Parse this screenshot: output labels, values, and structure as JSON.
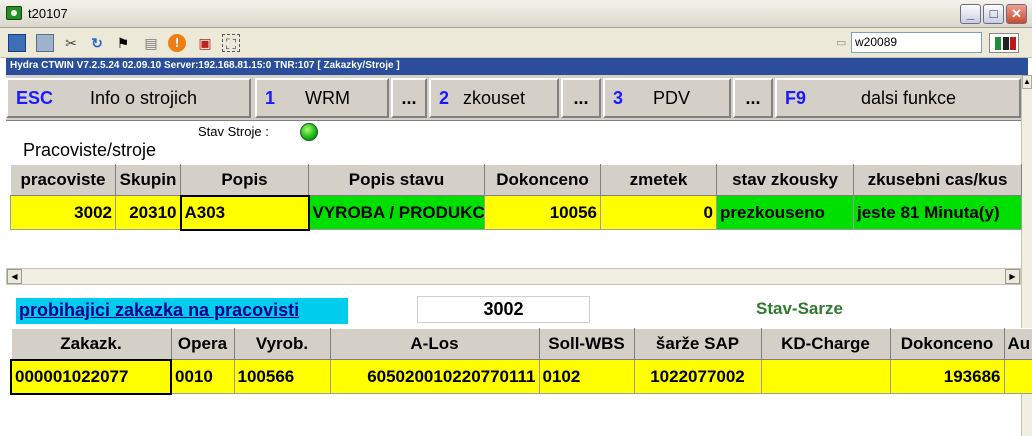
{
  "window": {
    "title": "t20107",
    "buttons": {
      "minimize": "_",
      "maximize": "□",
      "close": "✕"
    }
  },
  "toolbar": {
    "icons": [
      "monitor-icon",
      "windows-icon",
      "tools-icon",
      "refresh-icon",
      "windows-logo-icon",
      "printer-icon",
      "alert-icon",
      "network-icon",
      "fullscreen-icon"
    ],
    "terminal_value": "w20089"
  },
  "status_strip": {
    "text": "Hydra CTWIN V7.2.5.24  02.09.10  Server:192.168.81.15:0 TNR:107  [ Zakazky/Stroje ]"
  },
  "function_keys": [
    {
      "key": "ESC",
      "label": "Info o strojich"
    },
    {
      "key": "1",
      "label": "WRM"
    },
    {
      "key": "",
      "label": "..."
    },
    {
      "key": "2",
      "label": "zkouset"
    },
    {
      "key": "",
      "label": "..."
    },
    {
      "key": "3",
      "label": "PDV"
    },
    {
      "key": "",
      "label": "..."
    },
    {
      "key": "F9",
      "label": "dalsi funkce"
    }
  ],
  "machines": {
    "stav_label": "Stav Stroje :",
    "stav_color": "#13b313",
    "title": "Pracoviste/stroje",
    "columns": [
      "pracoviste",
      "Skupin",
      "Popis",
      "Popis stavu",
      "Dokonceno",
      "zmetek",
      "stav zkousky",
      "zkusebni cas/kus"
    ],
    "rows": [
      [
        "3002",
        "20310",
        "A303",
        "VYROBA / PRODUKCE",
        "10056",
        "0",
        "prezkouseno",
        "jeste  81 Minuta(y)"
      ]
    ]
  },
  "orders": {
    "title": "probihajici zakazka na pracovisti",
    "workplace": "3002",
    "stav_sarze": "Stav-Sarze",
    "columns": [
      "Zakazk.",
      "Opera",
      "Vyrob.",
      "A-Los",
      "Soll-WBS",
      "šarže SAP",
      "KD-Charge",
      "Dokonceno",
      "Au"
    ],
    "rows": [
      [
        "000001022077",
        "0010",
        "100566",
        "605020010220770111",
        "0102",
        "1022077002",
        "",
        "193686",
        ""
      ]
    ]
  },
  "colors": {
    "highlight_yellow": "#ffff00",
    "status_green": "#00e000",
    "title_strip": "#2a4e9c",
    "section_link_bg": "#00ccee"
  }
}
